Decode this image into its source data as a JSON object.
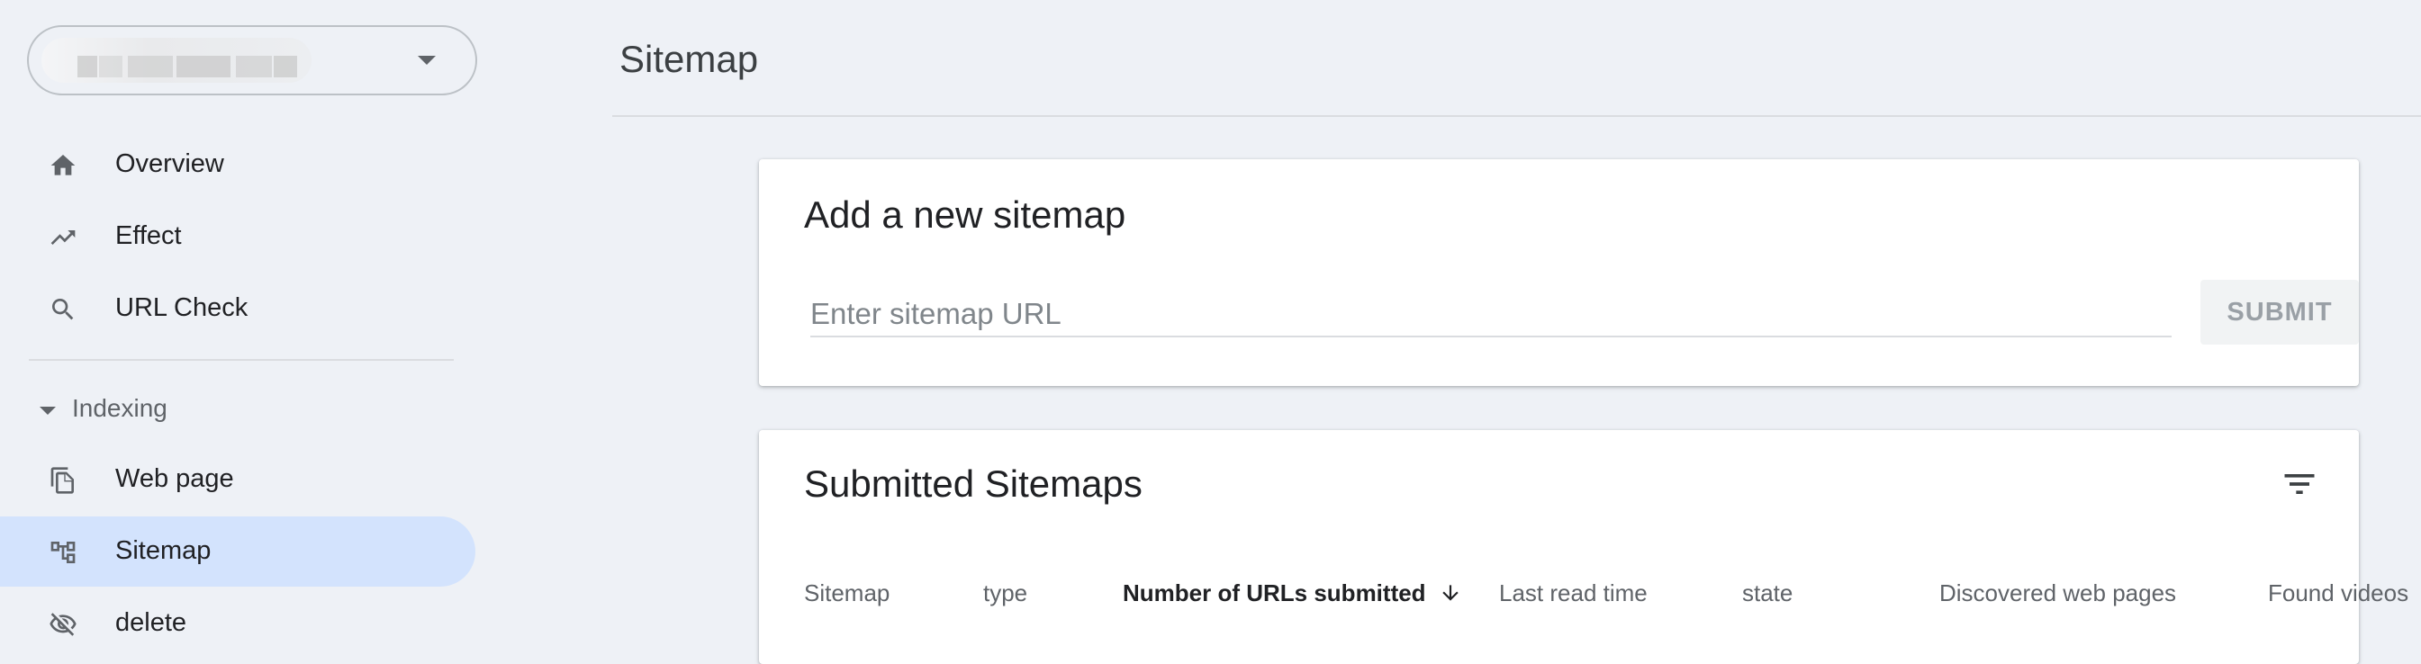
{
  "sidebar": {
    "property": {
      "placeholder": ""
    },
    "items": [
      {
        "label": "Overview",
        "icon": "home-icon"
      },
      {
        "label": "Effect",
        "icon": "trending-up-icon"
      },
      {
        "label": "URL Check",
        "icon": "search-icon"
      }
    ],
    "section": {
      "label": "Indexing"
    },
    "indexing_items": [
      {
        "label": "Web page",
        "icon": "file-copy-icon"
      },
      {
        "label": "Sitemap",
        "icon": "sitemap-icon",
        "active": true
      },
      {
        "label": "delete",
        "icon": "eye-off-icon"
      }
    ]
  },
  "header": {
    "title": "Sitemap"
  },
  "add_sitemap": {
    "title": "Add a new sitemap",
    "input_placeholder": "Enter sitemap URL",
    "input_value": "",
    "submit_label": "SUBMIT"
  },
  "submitted": {
    "title": "Submitted Sitemaps",
    "columns": [
      "Sitemap",
      "type",
      "Number of URLs submitted",
      "Last read time",
      "state",
      "Discovered web pages",
      "Found videos"
    ],
    "sorted_column": "Number of URLs submitted"
  },
  "colors": {
    "background": "#eef1f6",
    "active_nav": "#d3e3fd",
    "card": "#ffffff",
    "text_primary": "#202124",
    "text_secondary": "#5f6368"
  }
}
